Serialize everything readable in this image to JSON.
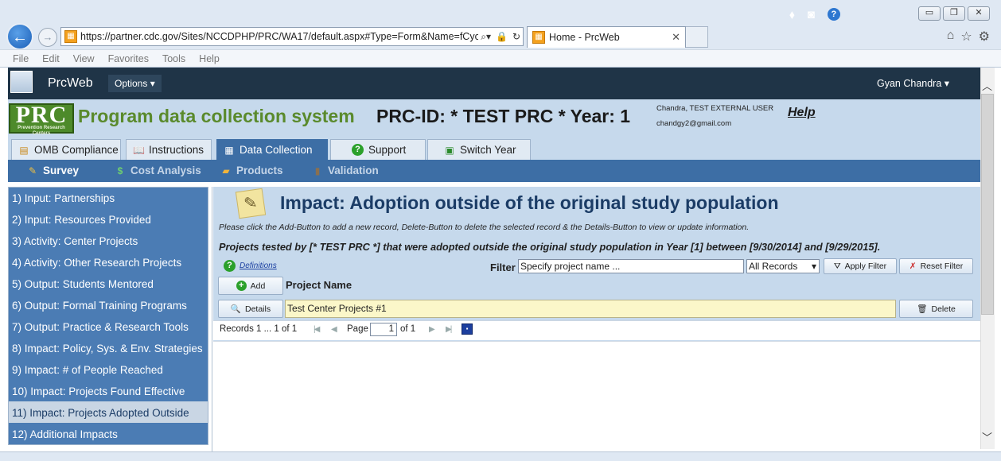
{
  "browser": {
    "url": "https://partner.cdc.gov/Sites/NCCDPHP/PRC/WA17/default.aspx#Type=Form&Name=fCyc",
    "tab_title": "Home - PrcWeb",
    "menu": [
      "File",
      "Edit",
      "View",
      "Favorites",
      "Tools",
      "Help"
    ]
  },
  "appbar": {
    "app_name": "PrcWeb",
    "options_label": "Options ▾",
    "user_name": "Gyan Chandra ▾"
  },
  "banner": {
    "logo_text": "PRC",
    "logo_subtext": "Prevention Research Centers",
    "system_title": "Program data collection system",
    "prc_id": "PRC-ID: * TEST PRC *  Year: 1",
    "user_line": "Chandra, TEST EXTERNAL USER",
    "user_email": "chandgy2@gmail.com",
    "help_label": "Help"
  },
  "main_tabs": [
    {
      "label": "OMB Compliance",
      "icon": "document-icon"
    },
    {
      "label": "Instructions",
      "icon": "book-icon"
    },
    {
      "label": "Data Collection",
      "icon": "table-icon",
      "active": true
    },
    {
      "label": "Support",
      "icon": "help-icon"
    },
    {
      "label": "Switch Year",
      "icon": "calendar-icon"
    }
  ],
  "sub_nav": [
    {
      "label": "Survey",
      "icon": "pencil-icon"
    },
    {
      "label": "Cost Analysis",
      "icon": "dollar-icon"
    },
    {
      "label": "Products",
      "icon": "folder-icon"
    },
    {
      "label": "Validation",
      "icon": "book-icon"
    }
  ],
  "left_nav": [
    "1) Input: Partnerships",
    "2) Input: Resources Provided",
    "3) Activity: Center Projects",
    "4) Activity: Other Research Projects",
    "5) Output: Students Mentored",
    "6) Output: Formal Training Programs",
    "7) Output: Practice & Research Tools",
    "8) Impact: Policy, Sys. & Env. Strategies",
    "9) Impact: # of People Reached",
    "10) Impact: Projects Found Effective",
    "11) Impact: Projects Adopted Outside",
    "12) Additional Impacts"
  ],
  "selected_left_nav_index": 10,
  "page": {
    "title": "Impact: Adoption outside of the original study population",
    "instructions": "Please click the Add-Button to add a new record, Delete-Button to delete the selected record & the Details-Button to view or update information.",
    "description": "Projects tested by [* TEST PRC *] that were adopted outside the original study population in Year [1] between [9/30/2014] and [9/29/2015].",
    "definitions_label": "Definitions",
    "filter_label": "Filter",
    "filter_value": "Specify project name ...",
    "filter_select": "All Records",
    "apply_filter_label": "Apply Filter",
    "reset_filter_label": "Reset Filter",
    "add_label": "Add",
    "column_header": "Project Name",
    "details_label": "Details",
    "delete_label": "Delete",
    "rows": [
      {
        "project_name": "Test Center Projects #1"
      }
    ]
  },
  "pager": {
    "records_text": "Records 1 ... 1 of 1",
    "page_label": "Page",
    "current_page": "1",
    "of_text": "of 1"
  },
  "colors": {
    "app_bar": "#1f3447",
    "banner_bg": "#c6d9ec",
    "accent_blue": "#3d6ea5",
    "left_nav_bg": "#4b7cb4",
    "title_green": "#5a8a2c",
    "title_blue": "#1b3c66",
    "row_highlight": "#fbf7c9"
  }
}
